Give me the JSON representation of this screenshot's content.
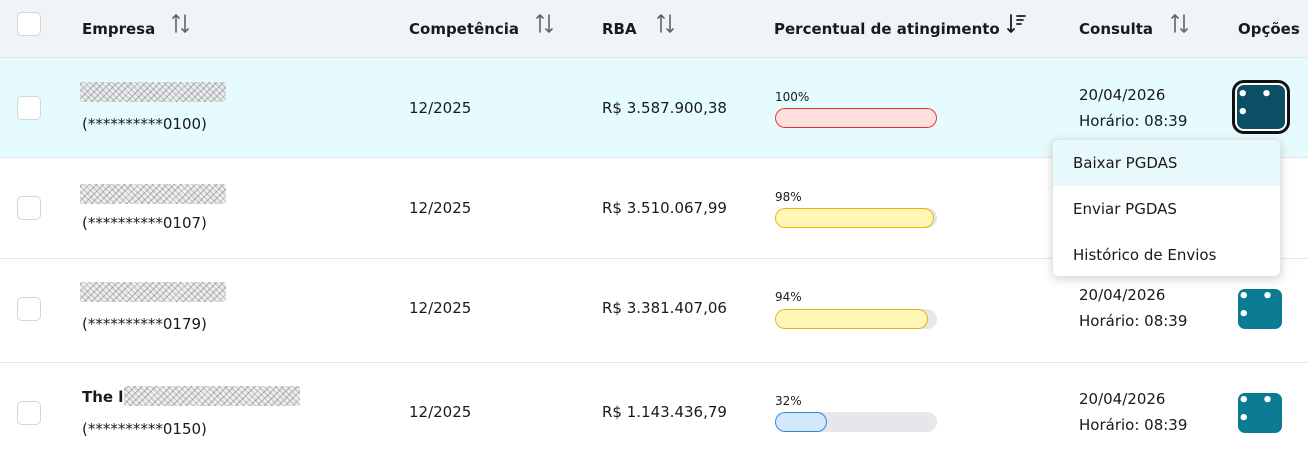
{
  "header": {
    "columns": {
      "empresa": "Empresa",
      "competencia": "Competência",
      "rba": "RBA",
      "percentual": "Percentual de atingimento",
      "consulta": "Consulta",
      "opcoes": "Opções"
    },
    "sort_icons": [
      "sort-both-icon",
      "sort-both-icon",
      "sort-both-icon",
      "sort-descending-icon",
      "sort-both-icon"
    ]
  },
  "rows": [
    {
      "name_prefix": "",
      "cnpj": "(**********0100)",
      "competencia": "12/2025",
      "rba": "R$ 3.587.900,38",
      "percent_label": "100%",
      "percent_value": 100,
      "bar_color": "#e0303e",
      "consulta_date": "20/04/2026",
      "consulta_time": "Horário: 08:39",
      "selected": true
    },
    {
      "name_prefix": "",
      "cnpj": "(**********0107)",
      "competencia": "12/2025",
      "rba": "R$ 3.510.067,99",
      "percent_label": "98%",
      "percent_value": 98,
      "bar_color": "#e3b60e",
      "consulta_date": "",
      "consulta_time": "",
      "selected": false
    },
    {
      "name_prefix": "",
      "cnpj": "(**********0179)",
      "competencia": "12/2025",
      "rba": "R$ 3.381.407,06",
      "percent_label": "94%",
      "percent_value": 94,
      "bar_color": "#e3b60e",
      "consulta_date": "20/04/2026",
      "consulta_time": "Horário: 08:39",
      "selected": false
    },
    {
      "name_prefix": "The l",
      "cnpj": "(**********0150)",
      "competencia": "12/2025",
      "rba": "R$ 1.143.436,79",
      "percent_label": "32%",
      "percent_value": 32,
      "bar_color": "#2f86d6",
      "consulta_date": "20/04/2026",
      "consulta_time": "Horário: 08:39",
      "selected": false
    }
  ],
  "options_button_label": "• • •",
  "menu": {
    "items": [
      "Baixar PGDAS",
      "Enviar PGDAS",
      "Histórico de Envios"
    ],
    "highlighted_index": 0
  },
  "colors": {
    "accent": "#0b7b93",
    "accent_active": "#0a4f63",
    "selected_row": "#e6fbfd",
    "header_bg": "#f1f4f7"
  }
}
